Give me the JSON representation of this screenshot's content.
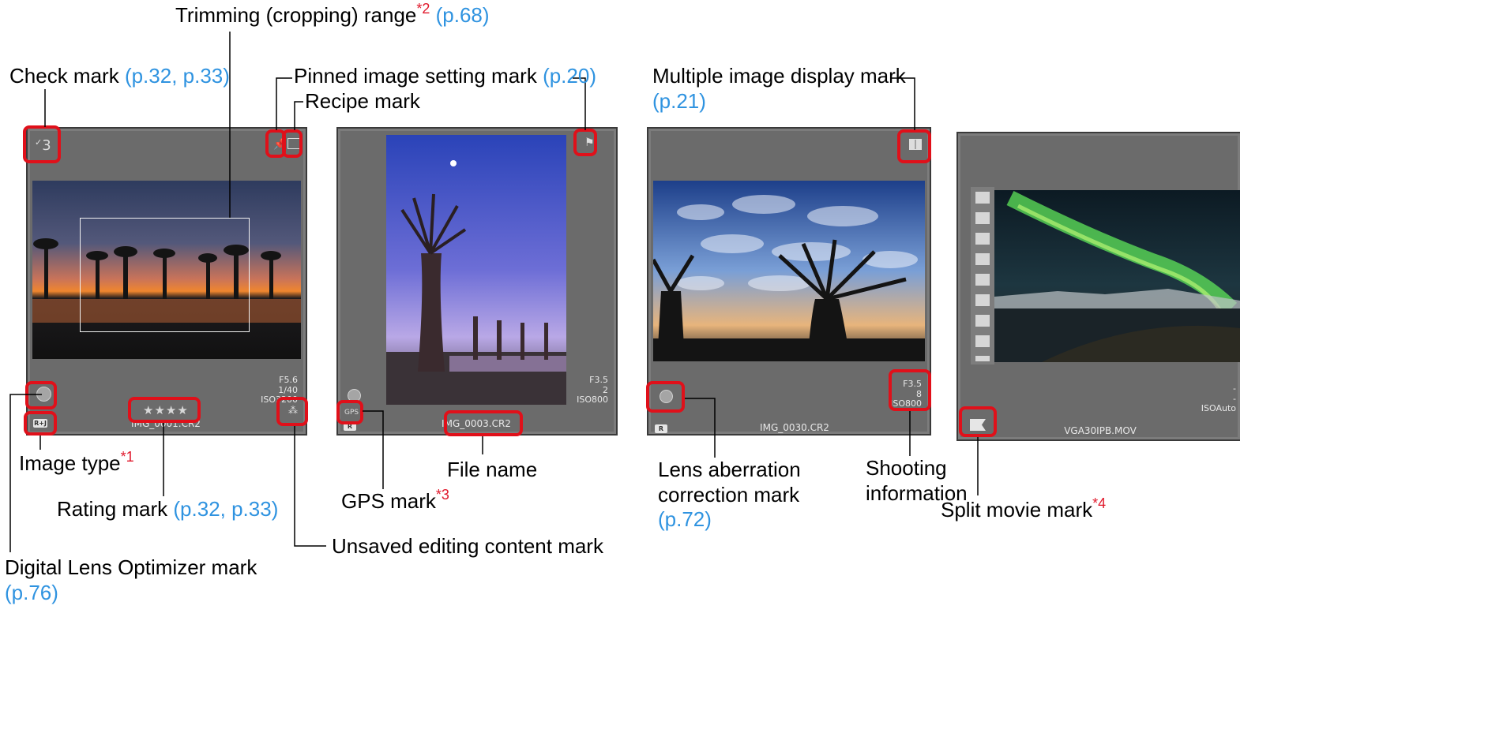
{
  "labels": {
    "trimming": {
      "text": "Trimming (cropping) range",
      "sup": "*2",
      "ref": "(p.68)"
    },
    "check": {
      "text": "Check mark",
      "ref": "(p.32, p.33)"
    },
    "pinned": {
      "text": "Pinned image setting mark",
      "ref": "(p.20)"
    },
    "recipe": {
      "text": "Recipe mark"
    },
    "multiple": {
      "text": "Multiple image display mark",
      "ref": "(p.21)"
    },
    "image_type": {
      "text": "Image type",
      "sup": "*1"
    },
    "file_name": {
      "text": "File name"
    },
    "rating": {
      "text": "Rating mark",
      "ref": "(p.32, p.33)"
    },
    "gps": {
      "text": "GPS mark",
      "sup": "*3"
    },
    "unsaved": {
      "text": "Unsaved editing content mark"
    },
    "dlo": {
      "text": "Digital Lens Optimizer mark",
      "ref": "(p.76)"
    },
    "lens_aberration": {
      "line1": "Lens aberration",
      "line2": "correction mark",
      "ref": "(p.72)"
    },
    "shooting": {
      "line1": "Shooting",
      "line2": "information"
    },
    "split_movie": {
      "text": "Split movie mark",
      "sup": "*4"
    }
  },
  "thumbnails": [
    {
      "check": "3",
      "info": [
        "F5.6",
        "1/40",
        "ISO3200"
      ],
      "file": "IMG_0001.CR2",
      "type_badge": "R+J",
      "stars": "★★★★"
    },
    {
      "info": [
        "F3.5",
        "2",
        "ISO800"
      ],
      "file": "IMG_0003.CR2",
      "gps": "GPS",
      "type_badge": "R"
    },
    {
      "info": [
        "F3.5",
        "8",
        "ISO800"
      ],
      "file": "IMG_0030.CR2",
      "type_badge": "R"
    },
    {
      "info": [
        "-",
        "-",
        "ISOAuto"
      ],
      "file": "VGA30IPB.MOV"
    }
  ],
  "colors": {
    "highlight": "#e0101a",
    "reference": "#2f93e0",
    "superscript": "#e0182b",
    "panel": "#6b6b6b"
  }
}
